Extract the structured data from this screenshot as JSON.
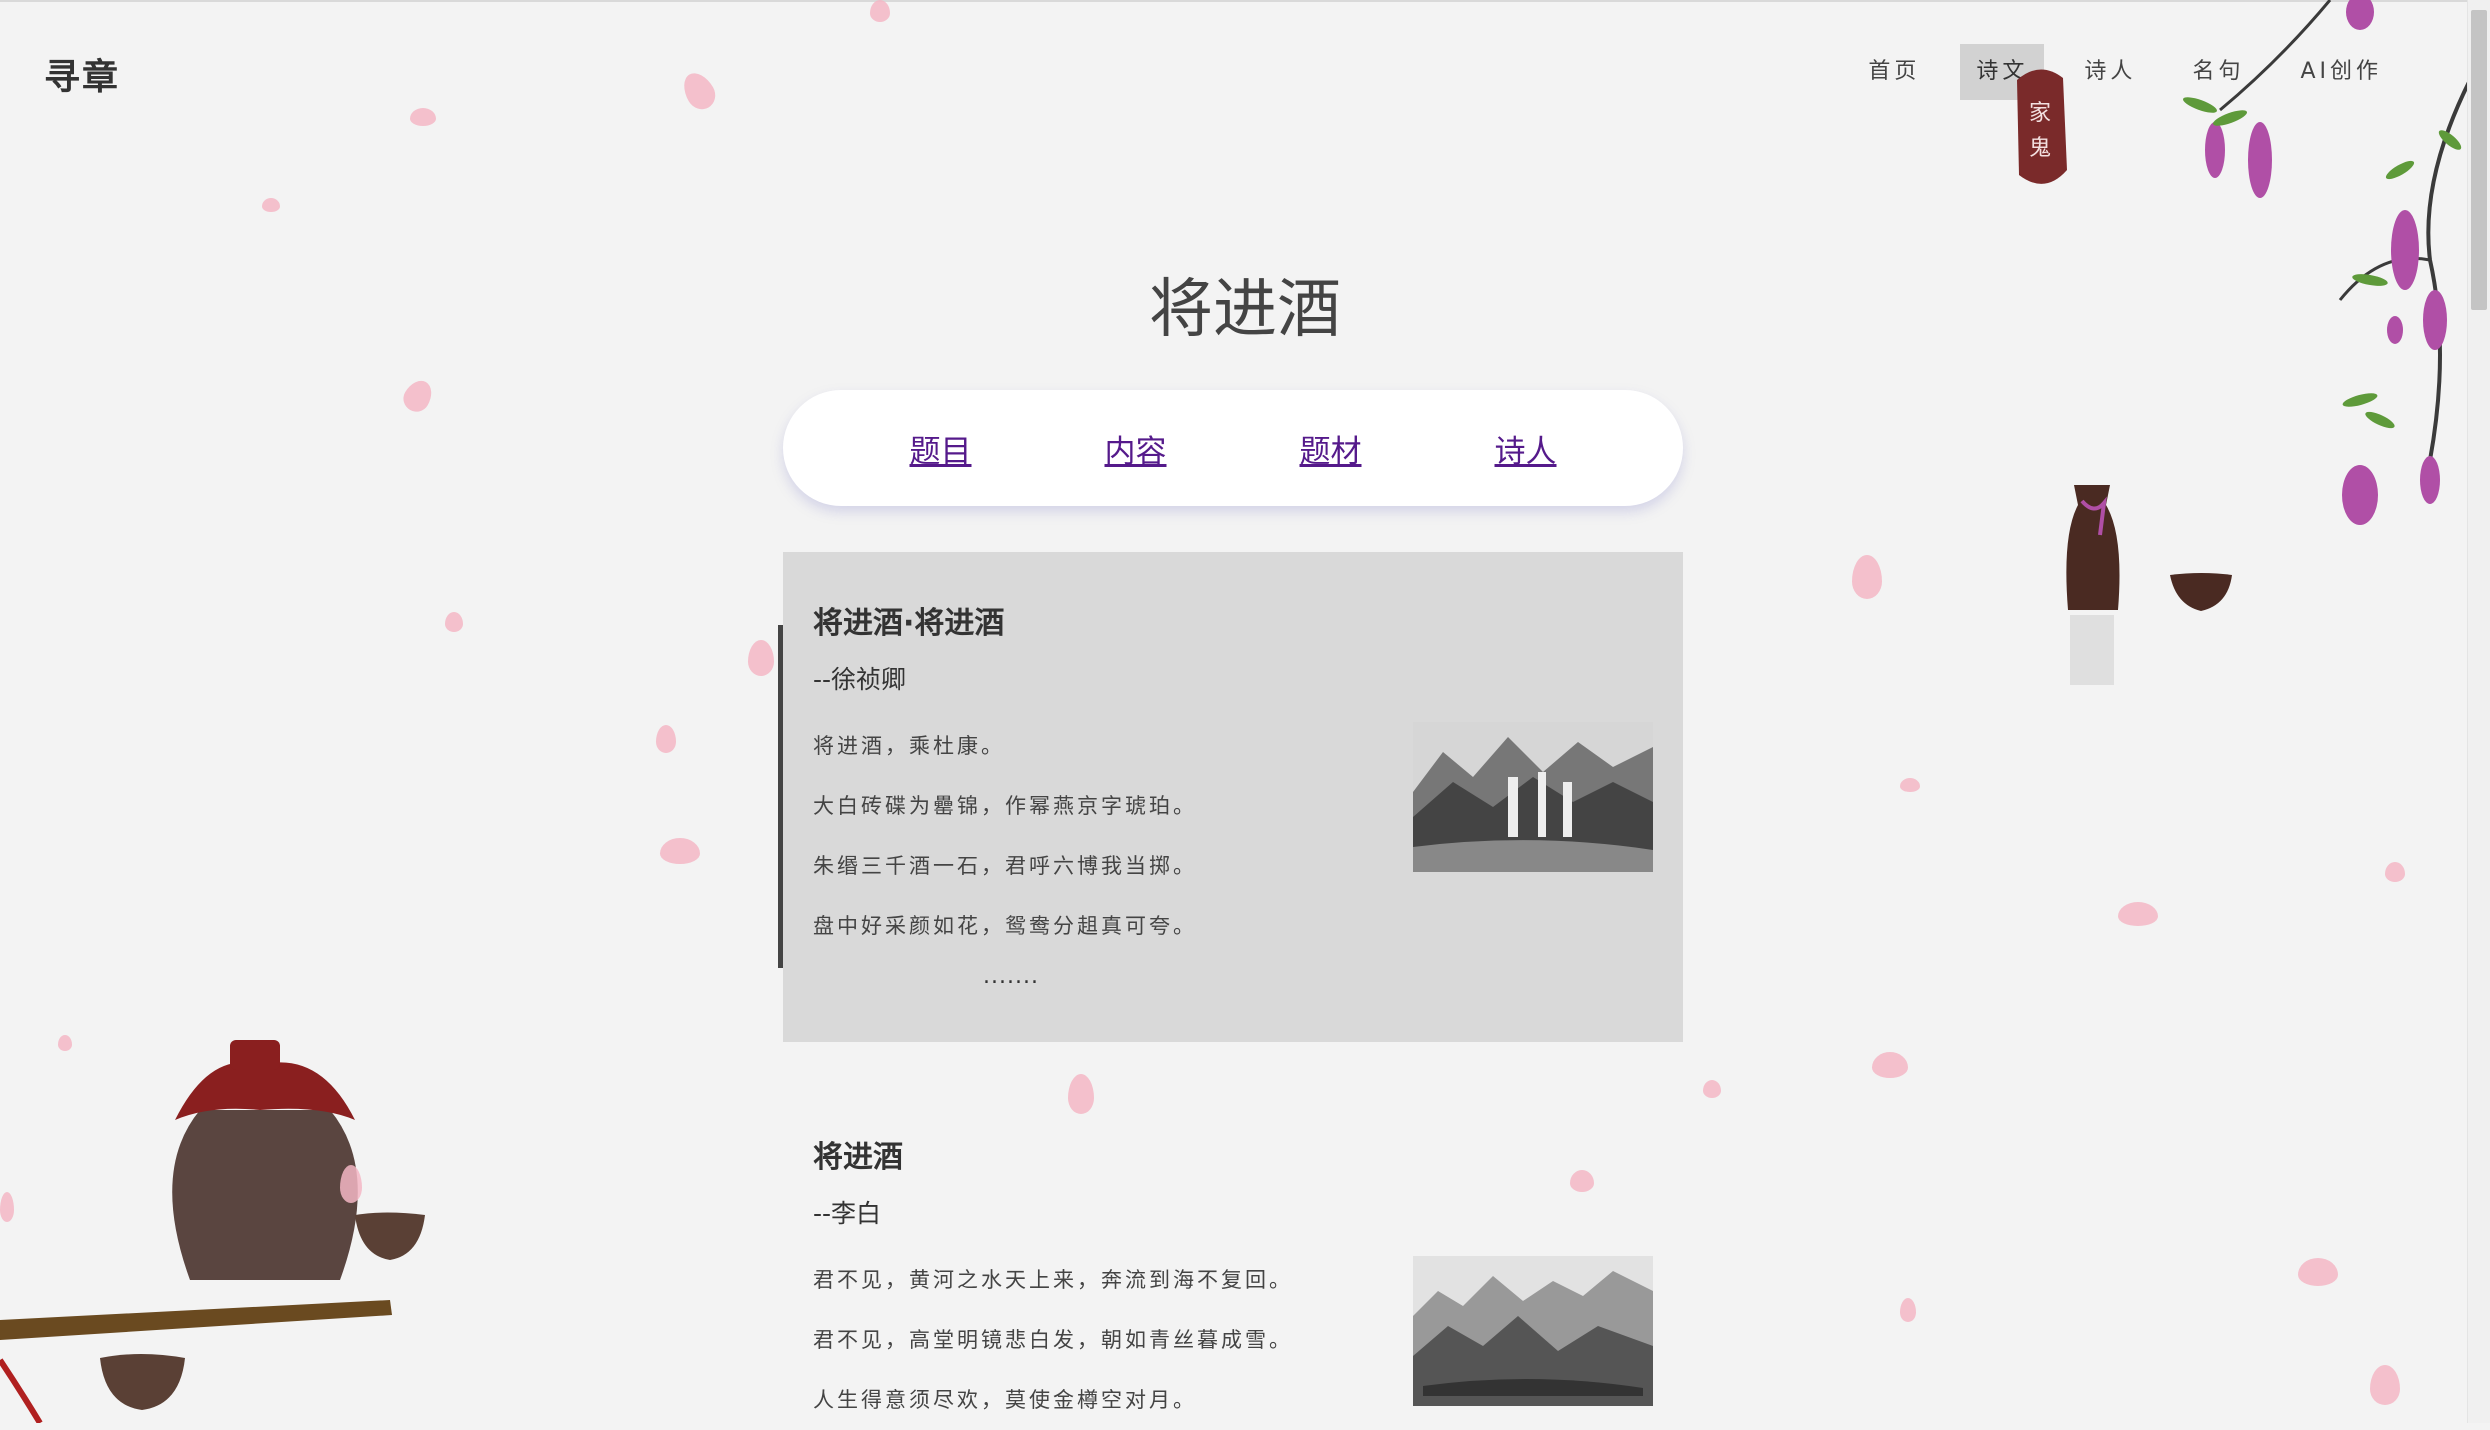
{
  "header": {
    "logo": "寻章",
    "nav": [
      {
        "label": "首页",
        "active": false
      },
      {
        "label": "诗文",
        "active": true
      },
      {
        "label": "诗人",
        "active": false
      },
      {
        "label": "名句",
        "active": false
      },
      {
        "label": "AI创作",
        "active": false
      }
    ]
  },
  "main": {
    "title": "将进酒",
    "tabs": [
      "题目",
      "内容",
      "题材",
      "诗人"
    ],
    "results": [
      {
        "title": "将进酒·将进酒",
        "author": "--徐祯卿",
        "lines": [
          "将进酒，乘杜康。",
          "大白砖碟为罍锦，作幂燕京字琥珀。",
          "朱缗三千酒一石，君呼六博我当掷。",
          "盘中好采颜如花，鸳鸯分趄真可夸。"
        ],
        "more": ".......",
        "image": "waterfall-landscape-painting"
      },
      {
        "title": "将进酒",
        "author": "--李白",
        "lines": [
          "君不见，黄河之水天上来，奔流到海不复回。",
          "君不见，高堂明镜悲白发，朝如青丝暮成雪。",
          "人生得意须尽欢，莫使金樽空对月。"
        ],
        "image": "mountain-landscape-painting"
      }
    ]
  },
  "decor": {
    "seal_text": "石家小鬼",
    "colors": {
      "petal": "#f3b6c4",
      "wisteria": "#b04fa6",
      "active_nav": "#d2d2d2",
      "card_bg": "#d9d9d9"
    }
  }
}
